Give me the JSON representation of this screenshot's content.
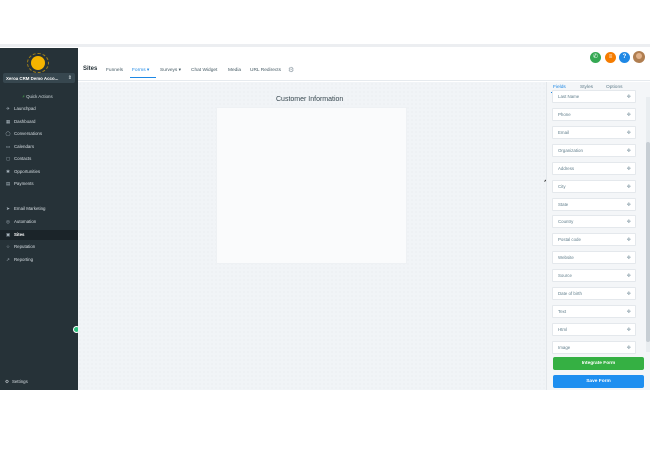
{
  "sidebar": {
    "account": "Xeroa CRM Demo Acco...",
    "quick_actions": "Quick Actions",
    "items": [
      {
        "label": "Launchpad",
        "icon": "rocket-icon",
        "glyph": "✈"
      },
      {
        "label": "Dashboard",
        "icon": "dashboard-icon",
        "glyph": "▦"
      },
      {
        "label": "Conversations",
        "icon": "chat-icon",
        "glyph": "◯"
      },
      {
        "label": "Calendars",
        "icon": "calendar-icon",
        "glyph": "▭"
      },
      {
        "label": "Contacts",
        "icon": "contacts-icon",
        "glyph": "▢"
      },
      {
        "label": "Opportunities",
        "icon": "opportunities-icon",
        "glyph": "✱"
      },
      {
        "label": "Payments",
        "icon": "payments-icon",
        "glyph": "▤"
      },
      {
        "label": "Email Marketing",
        "icon": "send-icon",
        "glyph": "➤"
      },
      {
        "label": "Automation",
        "icon": "automation-icon",
        "glyph": "◎"
      },
      {
        "label": "Sites",
        "icon": "sites-icon",
        "glyph": "▣"
      },
      {
        "label": "Reputation",
        "icon": "star-icon",
        "glyph": "☆"
      },
      {
        "label": "Reporting",
        "icon": "chart-icon",
        "glyph": "↗"
      }
    ],
    "settings": "Settings"
  },
  "header": {
    "title": "Sites",
    "tabs": [
      {
        "label": "Funnels"
      },
      {
        "label": "Forms ▾"
      },
      {
        "label": "Surveys ▾"
      },
      {
        "label": "Chat Widget"
      },
      {
        "label": "Media"
      },
      {
        "label": "URL Redirects"
      }
    ]
  },
  "canvas": {
    "form_title": "Customer Information"
  },
  "panel": {
    "tabs": [
      {
        "label": "Fields"
      },
      {
        "label": "Styles"
      },
      {
        "label": "Options"
      }
    ],
    "fields": [
      "Last Name",
      "Phone",
      "Email",
      "Organization",
      "Address",
      "City",
      "State",
      "Country",
      "Postal code",
      "Website",
      "Source",
      "Date of birth",
      "Text",
      "Html",
      "Image"
    ],
    "integrate_button": "Integrate Form",
    "save_button": "Save Form"
  },
  "colors": {
    "sidebar_bg": "#263238",
    "accent": "#1e88e5",
    "integrate_green": "#35b043",
    "save_blue": "#1e8ff0"
  }
}
